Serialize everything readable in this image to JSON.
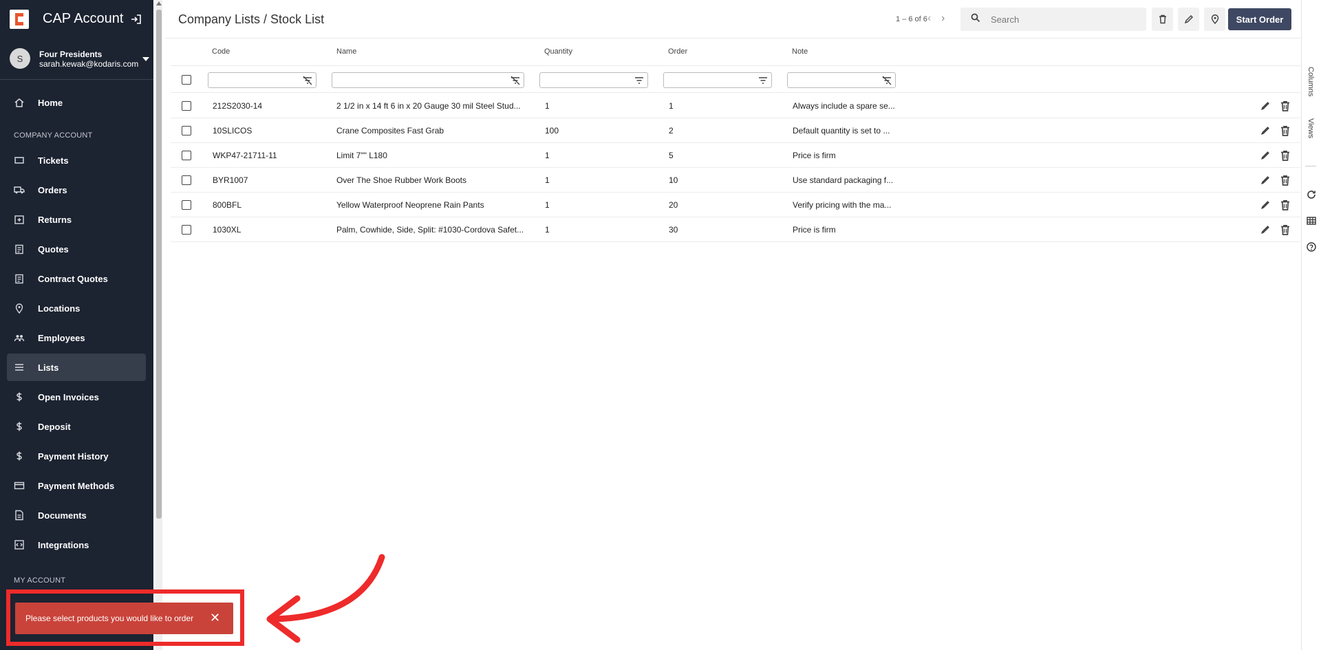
{
  "sidebar": {
    "brand": "CAP Account",
    "user": {
      "initial": "S",
      "name": "Four Presidents",
      "email": "sarah.kewak@kodaris.com"
    },
    "home": "Home",
    "section_company": "COMPANY ACCOUNT",
    "items": [
      {
        "label": "Tickets",
        "icon": "ticket-icon"
      },
      {
        "label": "Orders",
        "icon": "truck-icon"
      },
      {
        "label": "Returns",
        "icon": "returns-icon"
      },
      {
        "label": "Quotes",
        "icon": "clipboard-icon"
      },
      {
        "label": "Contract Quotes",
        "icon": "clipboard-icon"
      },
      {
        "label": "Locations",
        "icon": "pin-icon"
      },
      {
        "label": "Employees",
        "icon": "people-icon"
      },
      {
        "label": "Lists",
        "icon": "list-icon",
        "active": true
      },
      {
        "label": "Open Invoices",
        "icon": "dollar-icon"
      },
      {
        "label": "Deposit",
        "icon": "dollar-icon"
      },
      {
        "label": "Payment History",
        "icon": "dollar-icon"
      },
      {
        "label": "Payment Methods",
        "icon": "card-icon"
      },
      {
        "label": "Documents",
        "icon": "document-icon"
      },
      {
        "label": "Integrations",
        "icon": "integration-icon"
      }
    ],
    "section_my": "MY ACCOUNT"
  },
  "header": {
    "title": "Company Lists / Stock List",
    "pager": "1 – 6 of 6",
    "search_placeholder": "Search",
    "start_order": "Start Order"
  },
  "table": {
    "columns": [
      "Code",
      "Name",
      "Quantity",
      "Order",
      "Note"
    ],
    "rows": [
      {
        "code": "212S2030-14",
        "name": "2 1/2 in x 14 ft 6 in x 20 Gauge 30 mil Steel Stud...",
        "quantity": "1",
        "order": "1",
        "note": "Always include a spare se..."
      },
      {
        "code": "10SLICOS",
        "name": "Crane Composites Fast Grab",
        "quantity": "100",
        "order": "2",
        "note": "Default quantity is set to ..."
      },
      {
        "code": "WKP47-21711-11",
        "name": "Limit 7\"\" L180",
        "quantity": "1",
        "order": "5",
        "note": "Price is firm"
      },
      {
        "code": "BYR1007",
        "name": "Over The Shoe Rubber Work Boots",
        "quantity": "1",
        "order": "10",
        "note": "Use standard packaging f..."
      },
      {
        "code": "800BFL",
        "name": "Yellow Waterproof Neoprene Rain Pants",
        "quantity": "1",
        "order": "20",
        "note": "Verify pricing with the ma..."
      },
      {
        "code": "1030XL",
        "name": "Palm, Cowhide, Side, Split: #1030-Cordova Safet...",
        "quantity": "1",
        "order": "30",
        "note": "Price is firm"
      }
    ]
  },
  "rail": {
    "columns": "Columns",
    "views": "Views"
  },
  "toast": {
    "message": "Please select products you would like to order",
    "close": "✕"
  },
  "colors": {
    "sidebar": "#1c2331",
    "accent": "#3f4863",
    "toast": "#c9433a",
    "highlight": "#ee2b2b"
  }
}
